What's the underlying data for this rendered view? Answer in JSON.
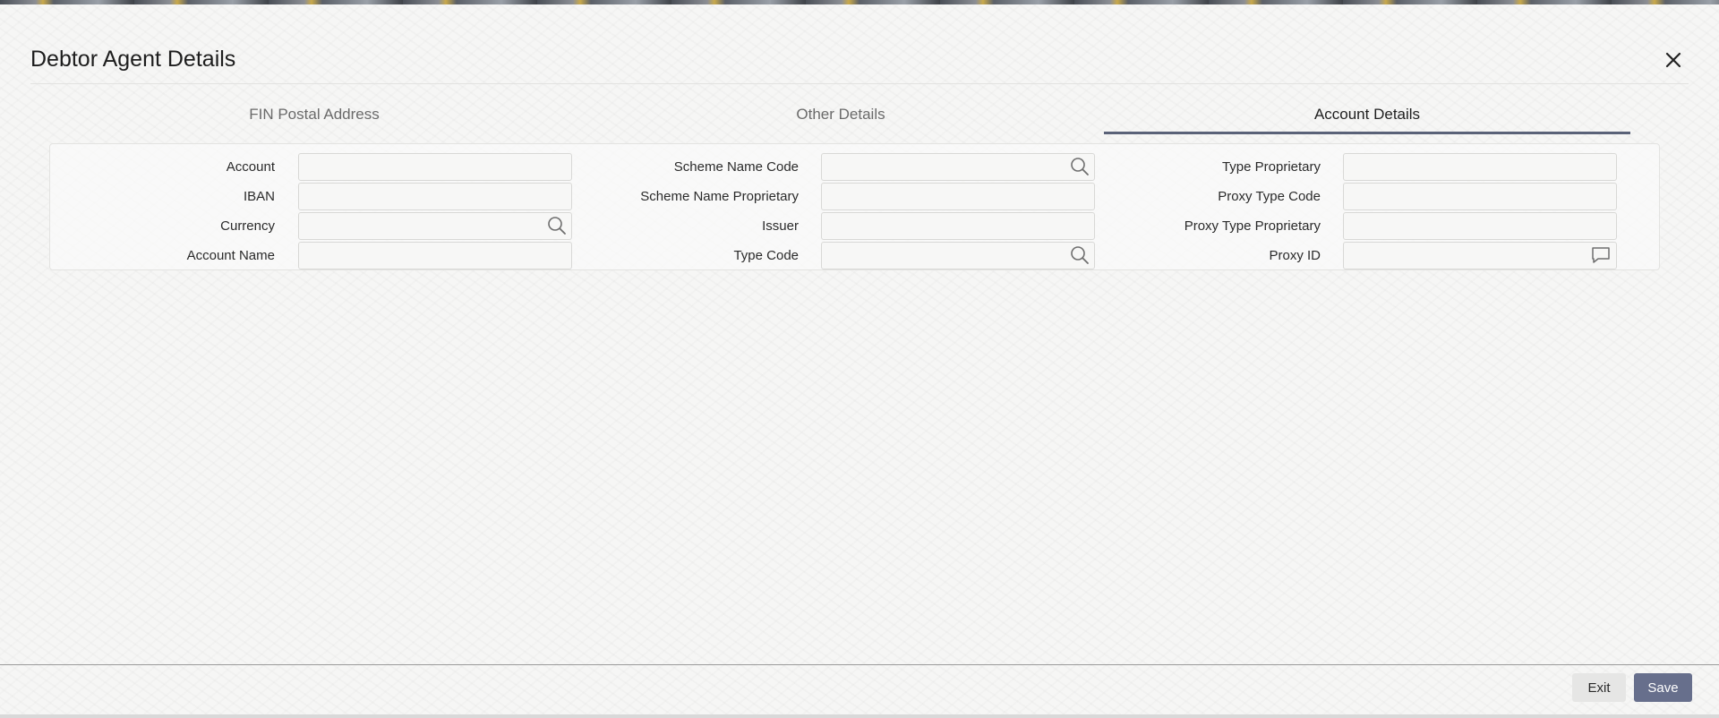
{
  "dialog": {
    "title": "Debtor Agent Details"
  },
  "tabs": [
    {
      "label": "FIN Postal Address",
      "active": false
    },
    {
      "label": "Other Details",
      "active": false
    },
    {
      "label": "Account Details",
      "active": true
    }
  ],
  "fields": {
    "account": {
      "label": "Account",
      "value": ""
    },
    "iban": {
      "label": "IBAN",
      "value": ""
    },
    "currency": {
      "label": "Currency",
      "value": "",
      "icon": "search-icon"
    },
    "account_name": {
      "label": "Account Name",
      "value": ""
    },
    "scheme_name_code": {
      "label": "Scheme Name Code",
      "value": "",
      "icon": "search-icon"
    },
    "scheme_name_proprietary": {
      "label": "Scheme Name Proprietary",
      "value": ""
    },
    "issuer": {
      "label": "Issuer",
      "value": ""
    },
    "type_code": {
      "label": "Type Code",
      "value": "",
      "icon": "search-icon"
    },
    "type_proprietary": {
      "label": "Type Proprietary",
      "value": ""
    },
    "proxy_type_code": {
      "label": "Proxy Type Code",
      "value": ""
    },
    "proxy_type_proprietary": {
      "label": "Proxy Type Proprietary",
      "value": ""
    },
    "proxy_id": {
      "label": "Proxy ID",
      "value": "",
      "icon": "comment-icon"
    }
  },
  "footer": {
    "exit_label": "Exit",
    "save_label": "Save"
  },
  "colors": {
    "accent": "#5a6278",
    "save_button": "#676f8c",
    "exit_button": "#e6e6e5"
  }
}
